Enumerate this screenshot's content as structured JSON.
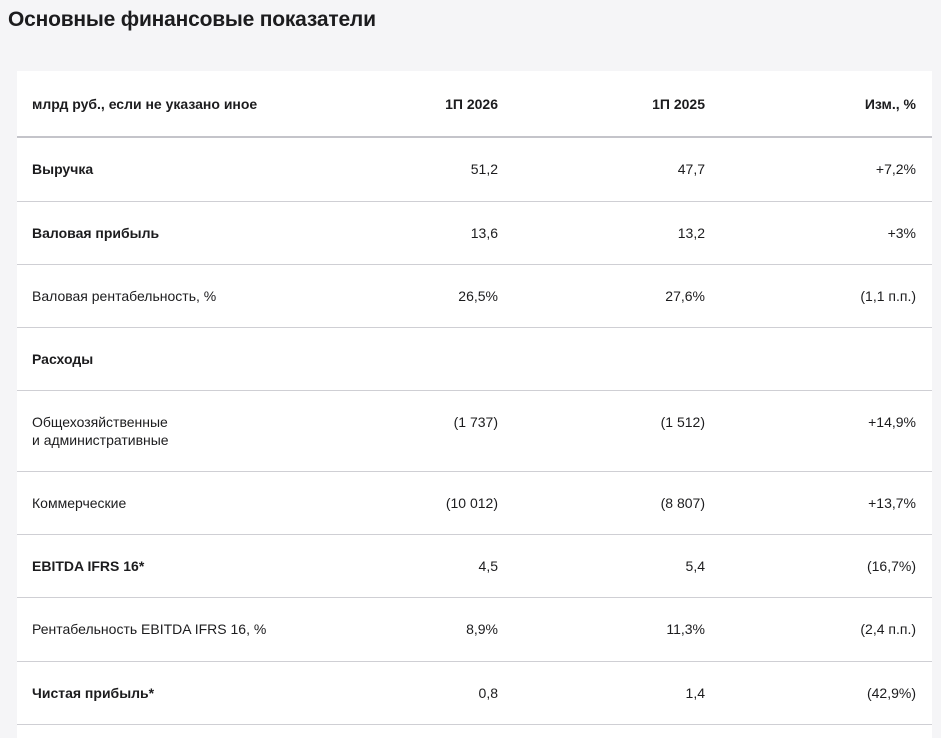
{
  "page_title": "Основные финансовые показатели",
  "table": {
    "headers": [
      "млрд руб., если не указано иное",
      "1П 2026",
      "1П 2025",
      "Изм., %"
    ],
    "rows": [
      {
        "label": "Выручка",
        "v2026": "51,2",
        "v2025": "47,7",
        "change": "+7,2%",
        "bold": true
      },
      {
        "label": "Валовая прибыль",
        "v2026": "13,6",
        "v2025": "13,2",
        "change": "+3%",
        "bold": true
      },
      {
        "label": "Валовая рентабельность, %",
        "v2026": "26,5%",
        "v2025": "27,6%",
        "change": "(1,1 п.п.)",
        "bold": false
      },
      {
        "label": "Расходы",
        "v2026": "",
        "v2025": "",
        "change": "",
        "bold": true
      },
      {
        "label_line1": "Общехозяйственные",
        "label_line2": "и административные",
        "v2026": "(1 737)",
        "v2025": "(1 512)",
        "change": "+14,9%",
        "bold": false
      },
      {
        "label": "Коммерческие",
        "v2026": "(10 012)",
        "v2025": "(8 807)",
        "change": "+13,7%",
        "bold": false
      },
      {
        "label": "EBITDA IFRS 16*",
        "v2026": "4,5",
        "v2025": "5,4",
        "change": "(16,7%)",
        "bold": true
      },
      {
        "label": "Рентабельность EBITDA IFRS 16, %",
        "v2026": "8,9%",
        "v2025": "11,3%",
        "change": "(2,4 п.п.)",
        "bold": false
      },
      {
        "label": "Чистая прибыль*",
        "v2026": "0,8",
        "v2025": "1,4",
        "change": "(42,9%)",
        "bold": true
      }
    ]
  }
}
